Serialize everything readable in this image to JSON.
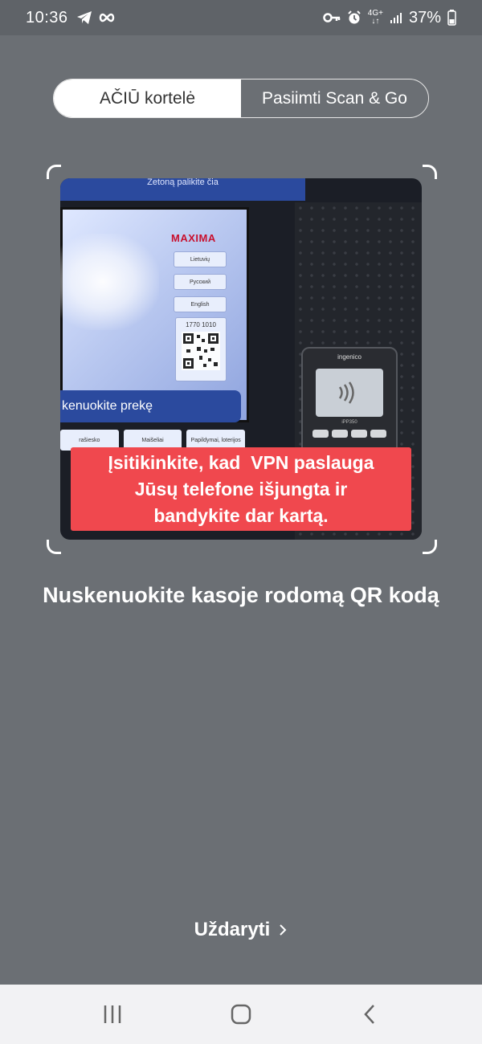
{
  "status_bar": {
    "time": "10:36",
    "battery": "37%",
    "network": "4G+",
    "icons": [
      "telegram-icon",
      "infinity-icon",
      "vpn-key-icon",
      "alarm-icon",
      "network-icon",
      "signal-icon",
      "battery-icon"
    ]
  },
  "tabs": [
    {
      "label": "AČIŪ kortelė",
      "active": true
    },
    {
      "label": "Pasiimti Scan & Go",
      "active": false
    }
  ],
  "camera": {
    "kiosk_header": "Žetoną palikite čia",
    "brand": "MAXIMA",
    "languages": [
      "Lietuvių",
      "Русский",
      "English"
    ],
    "qr_number": "1770 1010",
    "scan_text": "kenuokite prekę",
    "bottom_buttons": [
      "rašiesko",
      "Maišeliai",
      "Papildymai, loterijos"
    ],
    "terminal_brand": "ingenico",
    "terminal_model": "iPP350"
  },
  "error_message": {
    "lines": [
      "Įsitikinkite, kad  VPN paslauga",
      "Jūsų telefone išjungta ir",
      "bandykite dar kartą."
    ]
  },
  "instruction": "Nuskenuokite kasoje rodomą QR kodą",
  "close_label": "Uždaryti",
  "colors": {
    "background": "#6b6f74",
    "error": "#f0484e",
    "status_bar": "#5f6368",
    "nav_bar": "#f2f2f4"
  },
  "navigation_bar": [
    "recent-apps-icon",
    "home-icon",
    "back-icon"
  ]
}
